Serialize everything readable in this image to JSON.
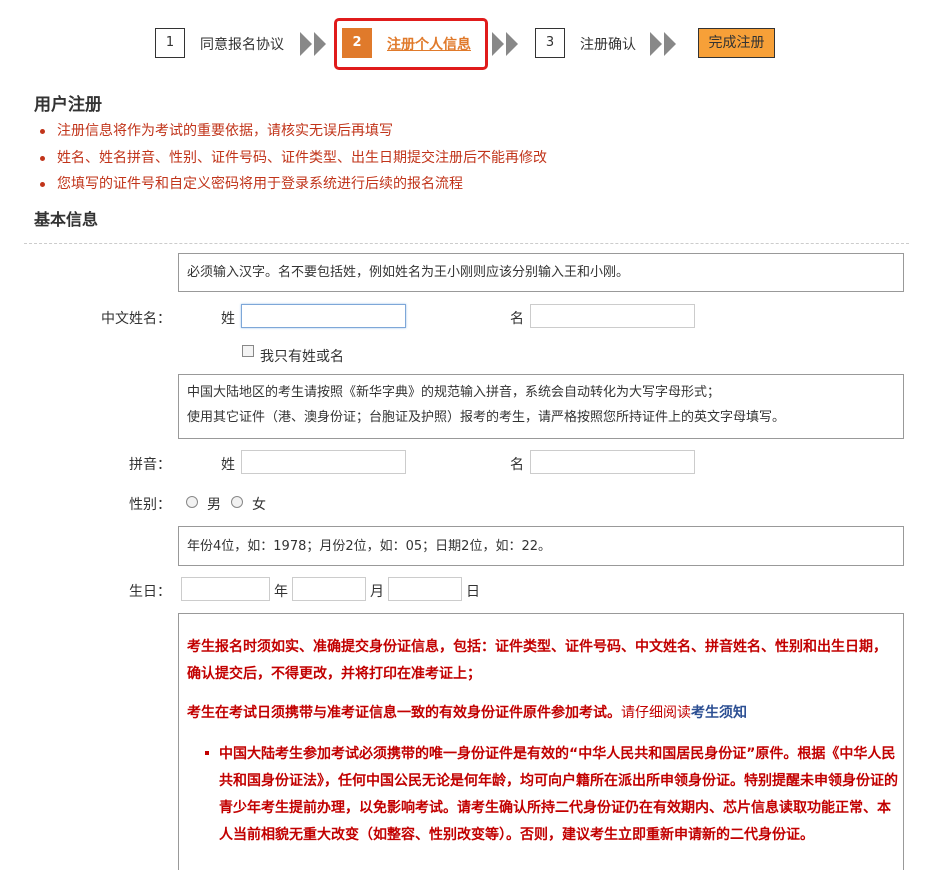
{
  "steps": [
    {
      "num": "1",
      "label": "同意报名协议"
    },
    {
      "num": "2",
      "label": "注册个人信息"
    },
    {
      "num": "3",
      "label": "注册确认"
    },
    {
      "label": "完成注册"
    }
  ],
  "heading": "用户注册",
  "notes": [
    "注册信息将作为考试的重要依据，请核实无误后再填写",
    "姓名、姓名拼音、性别、证件号码、证件类型、出生日期提交注册后不能再修改",
    "您填写的证件号和自定义密码将用于登录系统进行后续的报名流程"
  ],
  "basic_heading": "基本信息",
  "name": {
    "hint": "必须输入汉字。名不要包括姓，例如姓名为王小刚则应该分别输入王和小刚。",
    "label": "中文姓名：",
    "surname_label": "姓",
    "given_label": "名",
    "surname_value": "",
    "given_value": "",
    "only_one_label": "我只有姓或名"
  },
  "pinyin": {
    "hint_line1": "中国大陆地区的考生请按照《新华字典》的规范输入拼音，系统会自动转化为大写字母形式；",
    "hint_line2": "使用其它证件（港、澳身份证；台胞证及护照）报考的考生，请严格按照您所持证件上的英文字母填写。",
    "label": "拼音：",
    "surname_label": "姓",
    "given_label": "名",
    "surname_value": "",
    "given_value": ""
  },
  "gender": {
    "label": "性别：",
    "male": "男",
    "female": "女"
  },
  "birthday": {
    "hint": "年份4位，如：1978；月份2位，如：05；日期2位，如：22。",
    "label": "生日：",
    "year_label": "年",
    "month_label": "月",
    "day_label": "日",
    "year_value": "",
    "month_value": "",
    "day_value": ""
  },
  "notice": {
    "para1": "考生报名时须如实、准确提交身份证信息，包括：证件类型、证件号码、中文姓名、拼音姓名、性别和出生日期，确认提交后，不得更改，并将打印在准考证上；",
    "para2_bold": "考生在考试日须携带与准考证信息一致的有效身份证件原件参加考试。",
    "para2_normal": "请仔细阅读",
    "para2_link": "考生须知",
    "para3": "中国大陆考生参加考试必须携带的唯一身份证件是有效的“中华人民共和国居民身份证”原件。根据《中华人民共和国身份证法》，任何中国公民无论是何年龄，均可向户籍所在派出所申领身份证。特别提醒未申领身份证的青少年考生提前办理，以免影响考试。请考生确认所持二代身份证仍在有效期内、芯片信息读取功能正常、本人当前相貌无重大改变（如整容、性别改变等）。否则，建议考生立即重新申请新的二代身份证。"
  }
}
